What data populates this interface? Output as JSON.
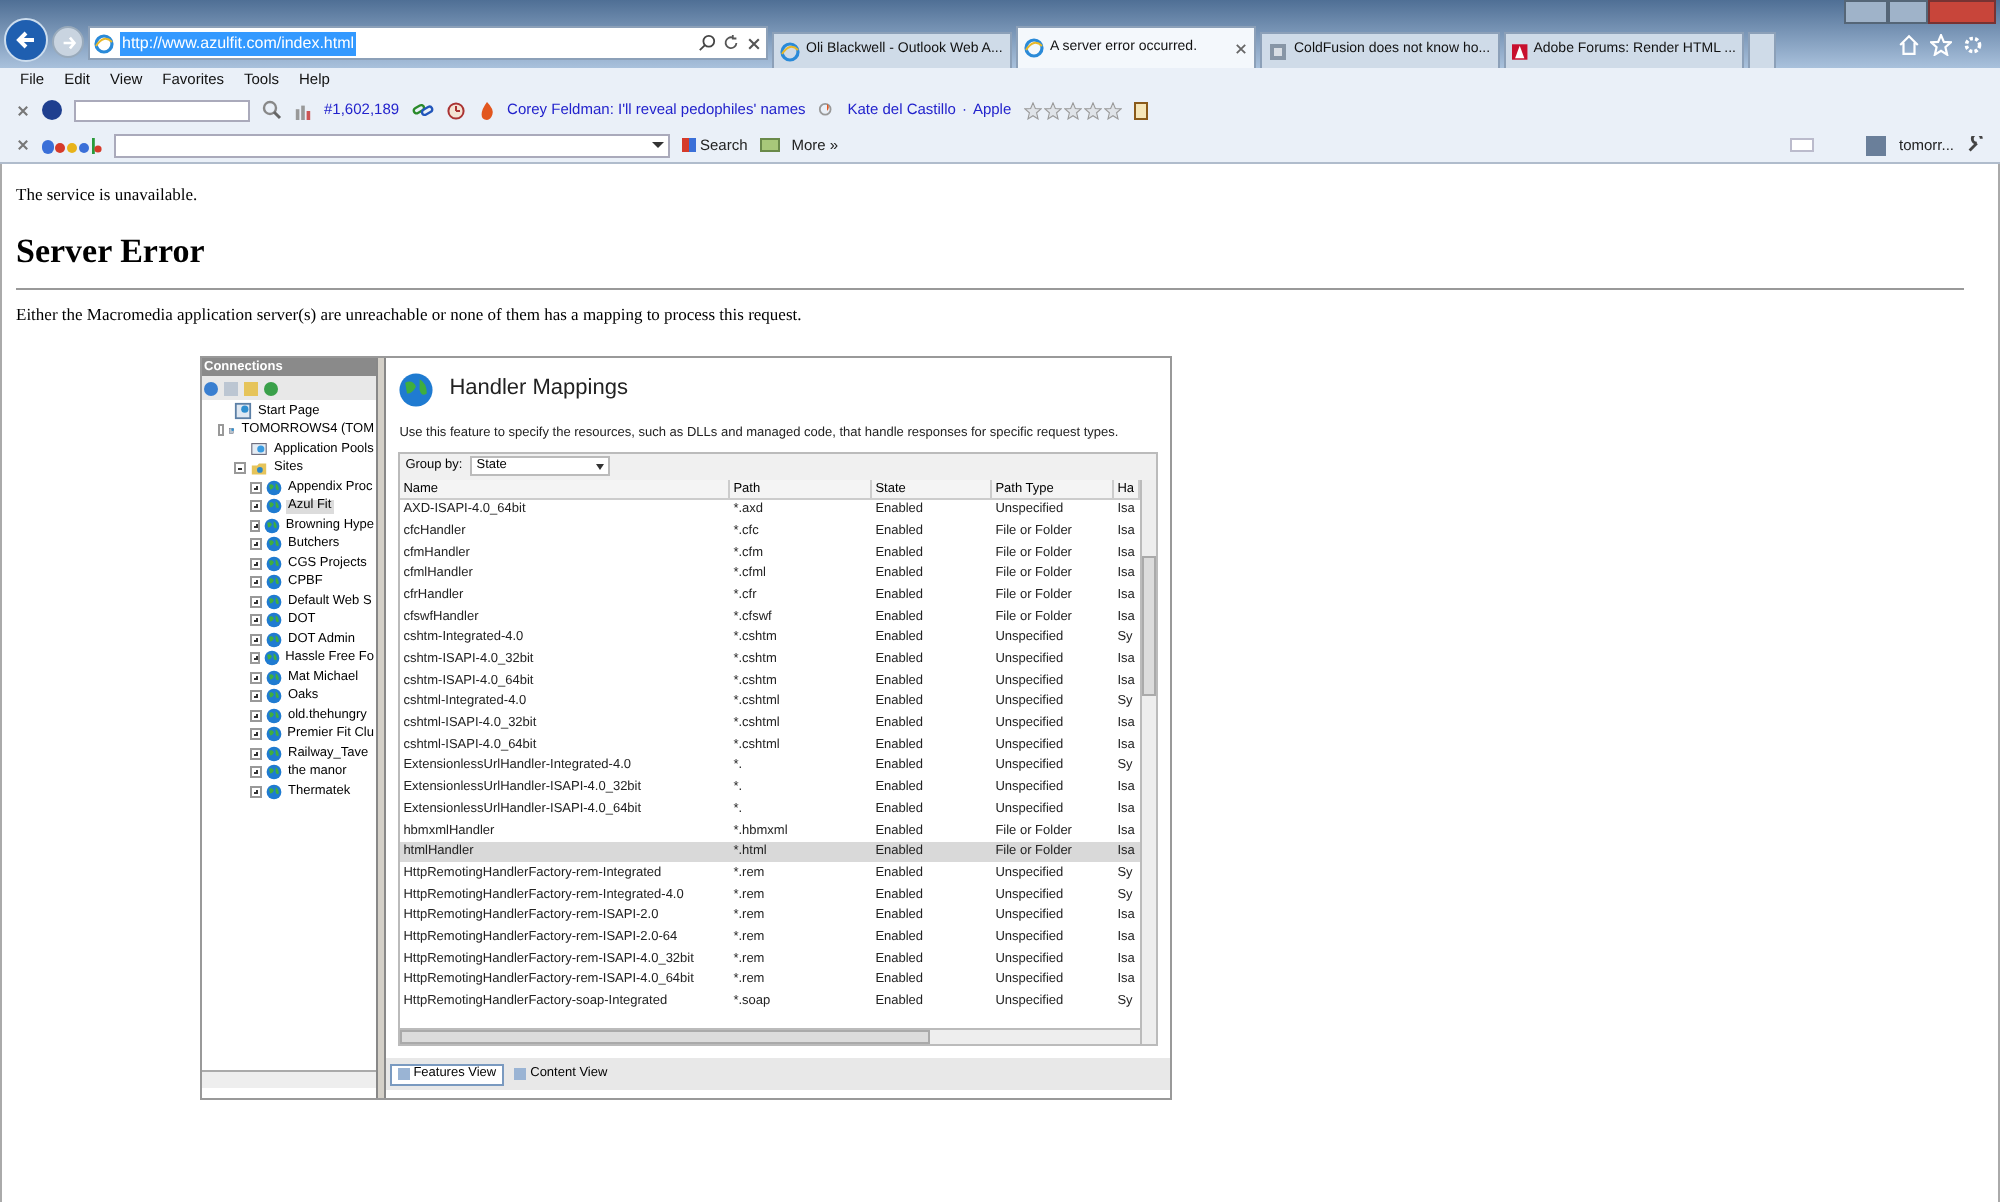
{
  "browser": {
    "address": "http://www.azulfit.com/index.html",
    "tabs": [
      {
        "label": "Oli Blackwell - Outlook Web A...",
        "selected": false,
        "kind": "ie"
      },
      {
        "label": "A server error occurred.",
        "selected": true,
        "kind": "ie"
      },
      {
        "label": "ColdFusion does not know ho...",
        "selected": false,
        "kind": "cf"
      },
      {
        "label": "Adobe Forums: Render HTML ...",
        "selected": false,
        "kind": "adobe"
      }
    ],
    "menu": [
      "File",
      "Edit",
      "View",
      "Favorites",
      "Tools",
      "Help"
    ],
    "toolbar": {
      "rank": "#1,602,189",
      "headline": "Corey Feldman: I'll reveal pedophiles' names",
      "news": [
        "Kate del Castillo",
        "·",
        "Apple"
      ],
      "stars": 0
    },
    "google_bar": {
      "search": "Search",
      "more": "More »",
      "user": "tomorr..."
    }
  },
  "page": {
    "notice": "The service is unavailable.",
    "heading": "Server Error",
    "message": "Either the Macromedia application server(s) are unreachable or none of them has a mapping to process this request."
  },
  "iis": {
    "connections_title": "Connections",
    "tree": [
      {
        "label": "Start Page",
        "kind": "page",
        "selected": false
      },
      {
        "label": "TOMORROWS4 (TOM",
        "kind": "server",
        "selected": false,
        "expanded": true,
        "children": [
          {
            "label": "Application Pools",
            "kind": "pools",
            "selected": false
          },
          {
            "label": "Sites",
            "kind": "folder",
            "selected": false,
            "expanded": true,
            "children": [
              {
                "label": "Appendix Proc",
                "kind": "globe",
                "selected": false,
                "expanded": false
              },
              {
                "label": "Azul Fit",
                "kind": "globe",
                "selected": true,
                "expanded": false
              },
              {
                "label": "Browning Hype",
                "kind": "globe",
                "selected": false,
                "expanded": false
              },
              {
                "label": "Butchers",
                "kind": "globe",
                "selected": false,
                "expanded": false
              },
              {
                "label": "CGS Projects",
                "kind": "globe",
                "selected": false,
                "expanded": false
              },
              {
                "label": "CPBF",
                "kind": "globe",
                "selected": false,
                "expanded": false
              },
              {
                "label": "Default Web S",
                "kind": "globe",
                "selected": false,
                "expanded": false
              },
              {
                "label": "DOT",
                "kind": "globe",
                "selected": false,
                "expanded": false
              },
              {
                "label": "DOT Admin",
                "kind": "globe",
                "selected": false,
                "expanded": false
              },
              {
                "label": "Hassle Free Fo",
                "kind": "globe",
                "selected": false,
                "expanded": false
              },
              {
                "label": "Mat Michael",
                "kind": "globe",
                "selected": false,
                "expanded": false
              },
              {
                "label": "Oaks",
                "kind": "globe",
                "selected": false,
                "expanded": false
              },
              {
                "label": "old.thehungry",
                "kind": "globe",
                "selected": false,
                "expanded": false
              },
              {
                "label": "Premier Fit Clu",
                "kind": "globe",
                "selected": false,
                "expanded": false
              },
              {
                "label": "Railway_Tave",
                "kind": "globe",
                "selected": false,
                "expanded": false
              },
              {
                "label": "the manor",
                "kind": "globe",
                "selected": false,
                "expanded": false
              },
              {
                "label": "Thermatek",
                "kind": "globe",
                "selected": false,
                "expanded": false
              }
            ]
          }
        ]
      }
    ],
    "feature_title": "Handler Mappings",
    "description": "Use this feature to specify the resources, such as DLLs and managed code, that handle responses for specific request types.",
    "group_by_label": "Group by:",
    "group_by_value": "State",
    "columns": [
      "Name",
      "Path",
      "State",
      "Path Type",
      "Ha"
    ],
    "rows": [
      {
        "cells": [
          "AXD-ISAPI-4.0_64bit",
          "*.axd",
          "Enabled",
          "Unspecified",
          "Isa"
        ],
        "selected": false
      },
      {
        "cells": [
          "cfcHandler",
          "*.cfc",
          "Enabled",
          "File or Folder",
          "Isa"
        ],
        "selected": false
      },
      {
        "cells": [
          "cfmHandler",
          "*.cfm",
          "Enabled",
          "File or Folder",
          "Isa"
        ],
        "selected": false
      },
      {
        "cells": [
          "cfmlHandler",
          "*.cfml",
          "Enabled",
          "File or Folder",
          "Isa"
        ],
        "selected": false
      },
      {
        "cells": [
          "cfrHandler",
          "*.cfr",
          "Enabled",
          "File or Folder",
          "Isa"
        ],
        "selected": false
      },
      {
        "cells": [
          "cfswfHandler",
          "*.cfswf",
          "Enabled",
          "File or Folder",
          "Isa"
        ],
        "selected": false
      },
      {
        "cells": [
          "cshtm-Integrated-4.0",
          "*.cshtm",
          "Enabled",
          "Unspecified",
          "Sy"
        ],
        "selected": false
      },
      {
        "cells": [
          "cshtm-ISAPI-4.0_32bit",
          "*.cshtm",
          "Enabled",
          "Unspecified",
          "Isa"
        ],
        "selected": false
      },
      {
        "cells": [
          "cshtm-ISAPI-4.0_64bit",
          "*.cshtm",
          "Enabled",
          "Unspecified",
          "Isa"
        ],
        "selected": false
      },
      {
        "cells": [
          "cshtml-Integrated-4.0",
          "*.cshtml",
          "Enabled",
          "Unspecified",
          "Sy"
        ],
        "selected": false
      },
      {
        "cells": [
          "cshtml-ISAPI-4.0_32bit",
          "*.cshtml",
          "Enabled",
          "Unspecified",
          "Isa"
        ],
        "selected": false
      },
      {
        "cells": [
          "cshtml-ISAPI-4.0_64bit",
          "*.cshtml",
          "Enabled",
          "Unspecified",
          "Isa"
        ],
        "selected": false
      },
      {
        "cells": [
          "ExtensionlessUrlHandler-Integrated-4.0",
          "*.",
          "Enabled",
          "Unspecified",
          "Sy"
        ],
        "selected": false
      },
      {
        "cells": [
          "ExtensionlessUrlHandler-ISAPI-4.0_32bit",
          "*.",
          "Enabled",
          "Unspecified",
          "Isa"
        ],
        "selected": false
      },
      {
        "cells": [
          "ExtensionlessUrlHandler-ISAPI-4.0_64bit",
          "*.",
          "Enabled",
          "Unspecified",
          "Isa"
        ],
        "selected": false
      },
      {
        "cells": [
          "hbmxmlHandler",
          "*.hbmxml",
          "Enabled",
          "File or Folder",
          "Isa"
        ],
        "selected": false
      },
      {
        "cells": [
          "htmlHandler",
          "*.html",
          "Enabled",
          "File or Folder",
          "Isa"
        ],
        "selected": true
      },
      {
        "cells": [
          "HttpRemotingHandlerFactory-rem-Integrated",
          "*.rem",
          "Enabled",
          "Unspecified",
          "Sy"
        ],
        "selected": false
      },
      {
        "cells": [
          "HttpRemotingHandlerFactory-rem-Integrated-4.0",
          "*.rem",
          "Enabled",
          "Unspecified",
          "Sy"
        ],
        "selected": false
      },
      {
        "cells": [
          "HttpRemotingHandlerFactory-rem-ISAPI-2.0",
          "*.rem",
          "Enabled",
          "Unspecified",
          "Isa"
        ],
        "selected": false
      },
      {
        "cells": [
          "HttpRemotingHandlerFactory-rem-ISAPI-2.0-64",
          "*.rem",
          "Enabled",
          "Unspecified",
          "Isa"
        ],
        "selected": false
      },
      {
        "cells": [
          "HttpRemotingHandlerFactory-rem-ISAPI-4.0_32bit",
          "*.rem",
          "Enabled",
          "Unspecified",
          "Isa"
        ],
        "selected": false
      },
      {
        "cells": [
          "HttpRemotingHandlerFactory-rem-ISAPI-4.0_64bit",
          "*.rem",
          "Enabled",
          "Unspecified",
          "Isa"
        ],
        "selected": false
      },
      {
        "cells": [
          "HttpRemotingHandlerFactory-soap-Integrated",
          "*.soap",
          "Enabled",
          "Unspecified",
          "Sy"
        ],
        "selected": false
      }
    ],
    "views": [
      {
        "label": "Features View",
        "selected": true
      },
      {
        "label": "Content View",
        "selected": false
      }
    ]
  }
}
